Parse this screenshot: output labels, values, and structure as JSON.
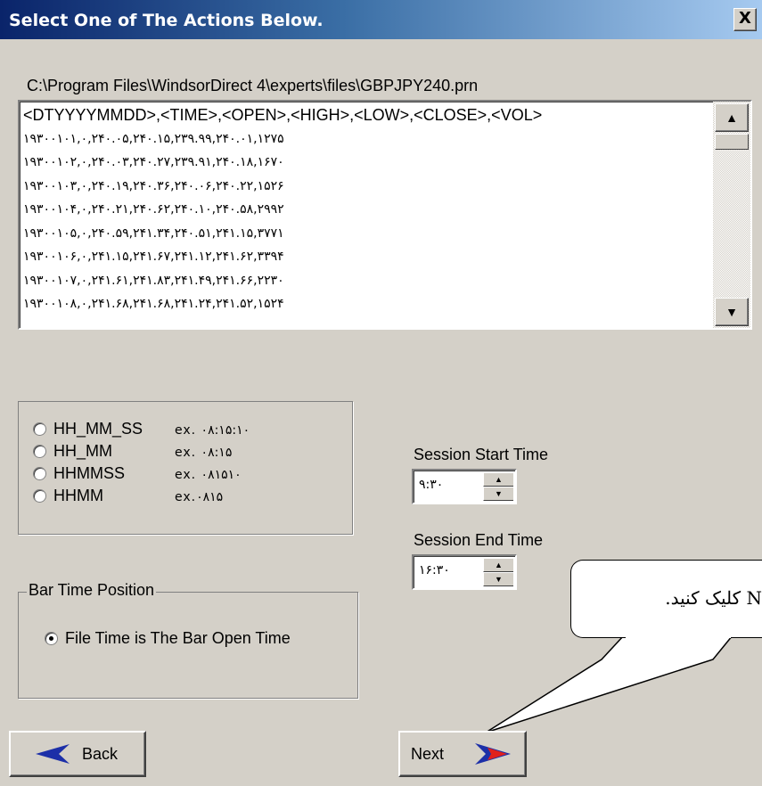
{
  "window": {
    "title": "Select One of The Actions Below.",
    "close_label": "X"
  },
  "file_path": "C:\\Program Files\\WindsorDirect 4\\experts\\files\\GBPJPY240.prn",
  "data_header": "<DTYYYYMMDD>,<TIME>,<OPEN>,<HIGH>,<LOW>,<CLOSE>,<VOL>",
  "data_lines": [
    "۱۹۳۰۰۱۰۱,۰,۲۴۰.۰۵,۲۴۰.۱۵,۲۳۹.۹۹,۲۴۰.۰۱,۱۲۷۵",
    "۱۹۳۰۰۱۰۲,۰,۲۴۰.۰۳,۲۴۰.۲۷,۲۳۹.۹۱,۲۴۰.۱۸,۱۶۷۰",
    "۱۹۳۰۰۱۰۳,۰,۲۴۰.۱۹,۲۴۰.۳۶,۲۴۰.۰۶,۲۴۰.۲۲,۱۵۲۶",
    "۱۹۳۰۰۱۰۴,۰,۲۴۰.۲۱,۲۴۰.۶۲,۲۴۰.۱۰,۲۴۰.۵۸,۲۹۹۲",
    "۱۹۳۰۰۱۰۵,۰,۲۴۰.۵۹,۲۴۱.۳۴,۲۴۰.۵۱,۲۴۱.۱۵,۳۷۷۱",
    "۱۹۳۰۰۱۰۶,۰,۲۴۱.۱۵,۲۴۱.۶۷,۲۴۱.۱۲,۲۴۱.۶۲,۳۳۹۴",
    "۱۹۳۰۰۱۰۷,۰,۲۴۱.۶۱,۲۴۱.۸۳,۲۴۱.۴۹,۲۴۱.۶۶,۲۲۳۰",
    "۱۹۳۰۰۱۰۸,۰,۲۴۱.۶۸,۲۴۱.۶۸,۲۴۱.۲۴,۲۴۱.۵۲,۱۵۲۴"
  ],
  "time_format": {
    "options": [
      {
        "label": "HH_MM_SS",
        "example": "ex. ۰۸:۱۵:۱۰",
        "selected": false
      },
      {
        "label": "HH_MM",
        "example": "ex. ۰۸:۱۵",
        "selected": false
      },
      {
        "label": "HHMMSS",
        "example": "ex. ۰۸۱۵۱۰",
        "selected": false
      },
      {
        "label": "HHMM",
        "example": "ex.۰۸۱۵",
        "selected": false
      }
    ]
  },
  "bar_time": {
    "legend": "Bar Time Position",
    "option_label": "File Time is The Bar Open Time",
    "selected": true
  },
  "session": {
    "start_label": "Session Start Time",
    "start_value": "۹:۳۰",
    "end_label": "Session End Time",
    "end_value": "۱۶:۳۰"
  },
  "callout_text": "N کلیک کنید.",
  "buttons": {
    "back_label": "Back",
    "next_label": "Next"
  },
  "colors": {
    "back_arrow": "#1c2fa8",
    "next_arrow_outer": "#1c2fa8",
    "next_arrow_inner": "#e0201c"
  }
}
